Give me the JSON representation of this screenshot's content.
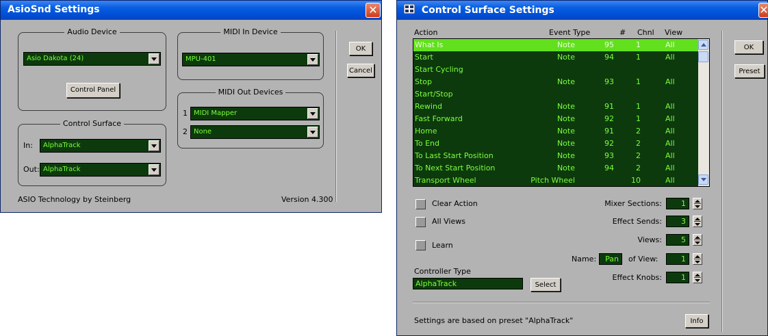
{
  "asio": {
    "title": "AsioSnd Settings",
    "audio_device": {
      "legend": "Audio Device",
      "value": "Asio Dakota (24)",
      "control_panel": "Control Panel"
    },
    "midi_in": {
      "legend": "MIDI In Device",
      "value": "MPU-401"
    },
    "midi_out": {
      "legend": "MIDI Out Devices",
      "devices": [
        {
          "num": "1",
          "value": "MIDI Mapper"
        },
        {
          "num": "2",
          "value": "None"
        }
      ]
    },
    "control_surface": {
      "legend": "Control Surface",
      "in_label": "In:",
      "in_value": "AlphaTrack",
      "out_label": "Out:",
      "out_value": "AlphaTrack"
    },
    "footer_left": "ASIO Technology by Steinberg",
    "footer_right": "Version 4.300",
    "ok": "OK",
    "cancel": "Cancel"
  },
  "cs": {
    "title": "Control Surface Settings",
    "columns": [
      "Action",
      "Event Type",
      "#",
      "Chnl",
      "View"
    ],
    "rows": [
      {
        "action": "What Is",
        "event": "Note",
        "num": "95",
        "chnl": "1",
        "view": "All",
        "selected": true
      },
      {
        "action": "Start",
        "event": "Note",
        "num": "94",
        "chnl": "1",
        "view": "All"
      },
      {
        "action": "Start Cycling",
        "event": "",
        "num": "",
        "chnl": "",
        "view": ""
      },
      {
        "action": "Stop",
        "event": "Note",
        "num": "93",
        "chnl": "1",
        "view": "All"
      },
      {
        "action": "Start/Stop",
        "event": "",
        "num": "",
        "chnl": "",
        "view": ""
      },
      {
        "action": "Rewind",
        "event": "Note",
        "num": "91",
        "chnl": "1",
        "view": "All"
      },
      {
        "action": "Fast Forward",
        "event": "Note",
        "num": "92",
        "chnl": "1",
        "view": "All"
      },
      {
        "action": "Home",
        "event": "Note",
        "num": "91",
        "chnl": "2",
        "view": "All"
      },
      {
        "action": "To End",
        "event": "Note",
        "num": "92",
        "chnl": "2",
        "view": "All"
      },
      {
        "action": "To Last Start Position",
        "event": "Note",
        "num": "93",
        "chnl": "2",
        "view": "All"
      },
      {
        "action": "To Next Start Position",
        "event": "Note",
        "num": "94",
        "chnl": "2",
        "view": "All"
      },
      {
        "action": "Transport Wheel",
        "event": "Pitch Wheel",
        "num": "",
        "chnl": "10",
        "view": "All"
      }
    ],
    "clear_action": "Clear Action",
    "all_views": "All Views",
    "learn": "Learn",
    "mixer_sections": {
      "label": "Mixer Sections:",
      "value": "1"
    },
    "effect_sends": {
      "label": "Effect Sends:",
      "value": "3"
    },
    "views": {
      "label": "Views:",
      "value": "5"
    },
    "name_label": "Name:",
    "name_value": "Pan",
    "of_view": {
      "label": "of View:",
      "value": "1"
    },
    "effect_knobs": {
      "label": "Effect Knobs:",
      "value": "1"
    },
    "controller_type_label": "Controller Type",
    "controller_type_value": "AlphaTrack",
    "select": "Select",
    "footer": "Settings are based on preset \"AlphaTrack\"",
    "info": "Info",
    "ok": "OK",
    "preset": "Preset"
  }
}
